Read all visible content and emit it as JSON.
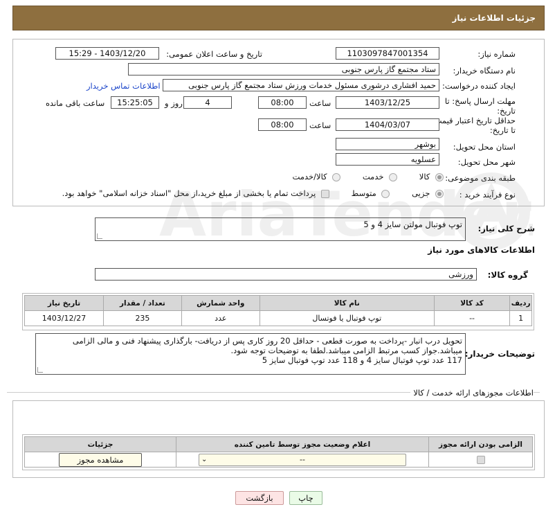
{
  "header": {
    "title": "جزئیات اطلاعات نیاز"
  },
  "form": {
    "need_number_label": "شماره نیاز:",
    "need_number": "1103097847001354",
    "announce_label": "تاریخ و ساعت اعلان عمومی:",
    "announce_value": "1403/12/20 - 15:29",
    "buyer_org_label": "نام دستگاه خریدار:",
    "buyer_org": "ستاد مجتمع گاز پارس جنوبی",
    "creator_label": "ایجاد کننده درخواست:",
    "creator": "حمید افشاری درشوری مسئول خدمات ورزش ستاد مجتمع گاز پارس جنوبی",
    "contact_link": "اطلاعات تماس خریدار",
    "deadline_label": "مهلت ارسال پاسخ: تا تاریخ:",
    "deadline_date": "1403/12/25",
    "time_label": "ساعت",
    "deadline_time": "08:00",
    "days_value": "4",
    "days_label": "روز و",
    "remaining_time": "15:25:05",
    "remaining_label": "ساعت باقی مانده",
    "validity_label": "حداقل تاریخ اعتبار قیمت: تا تاریخ:",
    "validity_date": "1404/03/07",
    "validity_time": "08:00",
    "province_label": "استان محل تحویل:",
    "province": "بوشهر",
    "city_label": "شهر محل تحویل:",
    "city": "عسلویه",
    "category_label": "طبقه بندی موضوعی:",
    "category_options": [
      "کالا",
      "خدمت",
      "کالا/خدمت"
    ],
    "process_label": "نوع فرآیند خرید :",
    "process_options": [
      "جزیی",
      "متوسط"
    ],
    "payment_note": "پرداخت تمام یا بخشی از مبلغ خرید،از محل \"اسناد خزانه اسلامی\" خواهد بود."
  },
  "summary": {
    "label": "شرح کلی نیاز:",
    "value": "توپ فوتبال مولتن سایز 4 و 5"
  },
  "goods": {
    "section_title": "اطلاعات کالاهای مورد نیاز",
    "group_label": "گروه کالا:",
    "group_value": "ورزشی",
    "columns": [
      "ردیف",
      "کد کالا",
      "نام کالا",
      "واحد شمارش",
      "تعداد / مقدار",
      "تاریخ نیاز"
    ],
    "rows": [
      {
        "row": "1",
        "code": "--",
        "name": "توپ فوتبال یا فوتسال",
        "unit": "عدد",
        "qty": "235",
        "date": "1403/12/27"
      }
    ]
  },
  "buyer_notes": {
    "label": "توضیحات خریدار:",
    "line1": "تحویل درب انبار -پرداخت به صورت قطعی - حداقل 20 روز کاری  پس از دریافت- بارگذاری پیشنهاد فنی و مالی الزامی",
    "line2": "میباشد.جواز کسب مرتبط الزامی میباشد.لطفا به توضیحات توجه شود.",
    "line3": "117 عدد توپ فوتبال سایز 4 و 118 عدد توپ فوتبال سایز 5"
  },
  "permits": {
    "section_title": "اطلاعات مجوزهای ارائه خدمت / کالا",
    "columns": [
      "الزامی بودن ارائه مجوز",
      "اعلام وضعیت مجوز توسط تامین کننده",
      "جزئیات"
    ],
    "select_value": "--",
    "view_button": "مشاهده مجوز"
  },
  "actions": {
    "print": "چاپ",
    "back": "بازگشت"
  },
  "watermark_text": "AriaTender.neT"
}
